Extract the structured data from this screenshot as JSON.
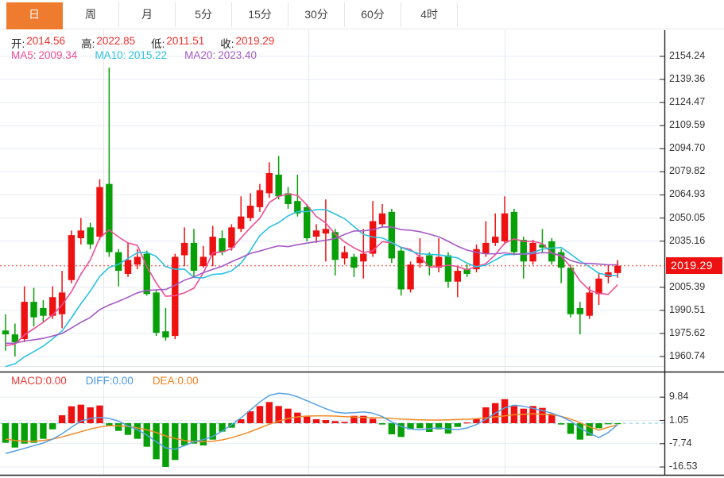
{
  "tabbar": {
    "tabs": [
      {
        "label": "日",
        "active": true
      },
      {
        "label": "周",
        "active": false
      },
      {
        "label": "月",
        "active": false
      },
      {
        "label": "5分",
        "active": false
      },
      {
        "label": "15分",
        "active": false
      },
      {
        "label": "30分",
        "active": false
      },
      {
        "label": "60分",
        "active": false
      },
      {
        "label": "4时",
        "active": false
      }
    ],
    "active_color": "#ef7b2f"
  },
  "readout": {
    "ohlc": {
      "open_label": "开:",
      "open": "2014.56",
      "high_label": "高:",
      "high": "2022.85",
      "low_label": "低:",
      "low": "2011.51",
      "close_label": "收:",
      "close": "2019.29",
      "value_color": "#f03030"
    },
    "ma": [
      {
        "label": "MA5:",
        "value": "2009.34",
        "color": "#ed4e95"
      },
      {
        "label": "MA10:",
        "value": "2015.22",
        "color": "#2ac2e2"
      },
      {
        "label": "MA20:",
        "value": "2023.40",
        "color": "#a45ac4"
      }
    ],
    "macd": [
      {
        "label": "MACD:",
        "value": "0.00",
        "color": "#f03c38"
      },
      {
        "label": "DIFF:",
        "value": "0.00",
        "color": "#4a97e4"
      },
      {
        "label": "DEA:",
        "value": "0.00",
        "color": "#f5821f"
      }
    ]
  },
  "colors": {
    "candle_up": "#ee1111",
    "candle_down": "#08a008",
    "ma5": "#ed4e95",
    "ma10": "#2ac2e2",
    "ma20": "#a45ac4",
    "diff_line": "#55a1e4",
    "dea_line": "#f08c28",
    "grid": "#e7ecf4",
    "vgrid": "#e2e8f2",
    "axis": "#222222",
    "last_price_dotted": "#fb6b66",
    "zero_dashed": "#8fd2ea",
    "tag_bg": "#ee1111"
  },
  "chart_data": {
    "type": "candlestick_with_macd",
    "title": "",
    "last_price": "2019.29",
    "price_axis_ticks": [
      "2154.24",
      "2139.36",
      "2124.47",
      "2109.59",
      "2094.70",
      "2079.82",
      "2064.93",
      "2050.05",
      "2035.16",
      "2005.39",
      "1990.51",
      "1975.62",
      "1960.74"
    ],
    "price_axis_range": [
      1960.74,
      2154.24
    ],
    "candles_format": "open_high_low_close",
    "candles": [
      [
        1977.5,
        1988,
        1964.5,
        1975
      ],
      [
        1975,
        1982,
        1960.8,
        1970
      ],
      [
        1972,
        2006,
        1970,
        1996
      ],
      [
        1996,
        2005,
        1980,
        1986
      ],
      [
        1992,
        1997,
        1983,
        1987
      ],
      [
        1987,
        2006,
        1985,
        1999
      ],
      [
        1988,
        2016,
        1979,
        2002
      ],
      [
        2010,
        2042,
        2008,
        2039
      ],
      [
        2037,
        2050,
        2033,
        2042
      ],
      [
        2044,
        2047,
        2030,
        2033
      ],
      [
        2038,
        2075,
        2036,
        2070
      ],
      [
        2072,
        2147,
        2025,
        2028
      ],
      [
        2028,
        2030,
        2006,
        2016
      ],
      [
        2014,
        2034,
        2012,
        2023
      ],
      [
        2020,
        2030,
        2017,
        2025
      ],
      [
        2027,
        2029,
        2000,
        2001
      ],
      [
        2002,
        2004,
        1974,
        1976
      ],
      [
        1977,
        1992,
        1971,
        1973
      ],
      [
        1974,
        2027,
        1972,
        2025
      ],
      [
        2026,
        2044,
        2019,
        2034
      ],
      [
        2034,
        2043,
        2012,
        2016
      ],
      [
        2019,
        2032,
        2018,
        2025
      ],
      [
        2026,
        2045,
        2019,
        2038
      ],
      [
        2037,
        2042,
        2026,
        2028
      ],
      [
        2031,
        2046,
        2029,
        2044
      ],
      [
        2043,
        2064,
        2041,
        2051
      ],
      [
        2050,
        2066,
        2048,
        2058
      ],
      [
        2057,
        2072,
        2054,
        2068
      ],
      [
        2066,
        2086,
        2063,
        2079
      ],
      [
        2078,
        2090,
        2062,
        2064
      ],
      [
        2066,
        2070,
        2056,
        2059
      ],
      [
        2061,
        2078,
        2051,
        2053
      ],
      [
        2057,
        2059,
        2035,
        2037
      ],
      [
        2038,
        2046,
        2034,
        2042
      ],
      [
        2040,
        2062,
        2022,
        2043
      ],
      [
        2041,
        2043,
        2013,
        2023
      ],
      [
        2024,
        2032,
        2020,
        2028
      ],
      [
        2025,
        2027,
        2012,
        2018
      ],
      [
        2022,
        2043,
        2011,
        2027
      ],
      [
        2027,
        2061,
        2025,
        2048
      ],
      [
        2046,
        2059,
        2044,
        2053
      ],
      [
        2054,
        2056,
        2021,
        2024
      ],
      [
        2029,
        2031,
        2000,
        2004
      ],
      [
        2004,
        2022,
        2002,
        2020
      ],
      [
        2021,
        2037,
        2018,
        2025
      ],
      [
        2026,
        2028,
        2013,
        2019
      ],
      [
        2018,
        2037,
        2015,
        2025
      ],
      [
        2026,
        2028,
        2005,
        2009
      ],
      [
        2009,
        2019,
        1999,
        2016
      ],
      [
        2017,
        2020,
        2012,
        2014
      ],
      [
        2017,
        2033,
        2015,
        2030
      ],
      [
        2027,
        2048,
        2025,
        2034
      ],
      [
        2034,
        2053,
        2032,
        2038
      ],
      [
        2035,
        2064,
        2033,
        2053
      ],
      [
        2054,
        2056,
        2026,
        2028
      ],
      [
        2036,
        2038,
        2011,
        2022
      ],
      [
        2022,
        2036,
        2020,
        2034
      ],
      [
        2033,
        2043,
        2028,
        2031
      ],
      [
        2035,
        2037,
        2020,
        2022
      ],
      [
        2028,
        2030,
        2008,
        2018
      ],
      [
        2018,
        2020,
        1986,
        1988
      ],
      [
        1992,
        1996,
        1975,
        1988
      ],
      [
        1987,
        2006,
        1985,
        2002
      ],
      [
        2001,
        2015,
        1994,
        2011
      ],
      [
        2012,
        2020,
        2008,
        2015
      ],
      [
        2014.56,
        2022.85,
        2011.51,
        2019.29
      ]
    ],
    "ma_periods": [
      5,
      10,
      20
    ],
    "ma_starts": {
      "ma5": 1966,
      "ma10": 1952,
      "ma20": 1969
    },
    "macd_axis_ticks": [
      "9.84",
      "1.05",
      "-7.74",
      "-16.53"
    ],
    "macd_histogram": [
      -7.4,
      -9.2,
      -7.7,
      -7.4,
      -5.9,
      -2.3,
      3.0,
      6.4,
      7.0,
      6.0,
      6.7,
      -0.8,
      -2.9,
      -4.4,
      -5.9,
      -8.9,
      -13.6,
      -16.5,
      -13.9,
      -8.4,
      -7.7,
      -8.4,
      -6.2,
      -3.2,
      -1.7,
      1.5,
      4.5,
      6.5,
      8.0,
      6.5,
      5.5,
      4.0,
      2.5,
      1.5,
      1.2,
      0.8,
      0.5,
      2.8,
      2.8,
      1.7,
      -0.5,
      -4.2,
      -5.2,
      -2.3,
      -1.9,
      -3.3,
      -2.3,
      -3.9,
      -1.4,
      0.3,
      1.6,
      6.0,
      7.6,
      9.1,
      6.5,
      5.5,
      6.5,
      5.8,
      3.6,
      -0.5,
      -4.0,
      -6.2,
      -4.7,
      -1.9,
      -0.4,
      -0.3
    ],
    "diff_line": [
      -11.4,
      -10.5,
      -9.5,
      -8.5,
      -7.5,
      -6.0,
      -4.0,
      -1.5,
      0.8,
      1.8,
      2.2,
      1.8,
      0.8,
      -1.0,
      -2.5,
      -4.5,
      -7.0,
      -9.3,
      -9.8,
      -8.5,
      -7.0,
      -6.2,
      -5.0,
      -3.0,
      -0.5,
      2.0,
      5.0,
      8.0,
      10.5,
      11.3,
      11.0,
      10.0,
      8.5,
      7.0,
      5.5,
      4.2,
      3.8,
      4.0,
      4.3,
      3.8,
      2.5,
      0.5,
      -1.2,
      -2.2,
      -2.5,
      -2.0,
      -1.8,
      -2.2,
      -2.4,
      -1.8,
      -0.5,
      1.5,
      3.8,
      5.8,
      6.8,
      6.4,
      5.6,
      4.8,
      3.8,
      2.5,
      0.8,
      -1.8,
      -3.8,
      -5.4,
      -3.5,
      -0.5
    ],
    "dea_line": [
      -6.0,
      -6.5,
      -6.8,
      -6.8,
      -6.5,
      -6.0,
      -5.2,
      -4.2,
      -3.2,
      -2.2,
      -1.4,
      -1.0,
      -1.0,
      -1.2,
      -1.8,
      -2.5,
      -3.5,
      -4.8,
      -5.8,
      -6.5,
      -6.9,
      -7.0,
      -6.8,
      -6.3,
      -5.5,
      -4.4,
      -3.2,
      -1.8,
      -0.4,
      0.8,
      1.8,
      2.4,
      2.7,
      2.8,
      2.8,
      2.7,
      2.5,
      2.3,
      2.2,
      2.1,
      2.0,
      1.8,
      1.6,
      1.4,
      1.3,
      1.2,
      1.2,
      1.3,
      1.4,
      1.5,
      1.7,
      2.0,
      2.4,
      2.8,
      3.2,
      3.4,
      3.5,
      3.4,
      3.2,
      2.6,
      1.6,
      0.2,
      -1.4,
      -2.6,
      -1.5,
      -0.6
    ],
    "legend_position": "top-left",
    "grid": true
  }
}
